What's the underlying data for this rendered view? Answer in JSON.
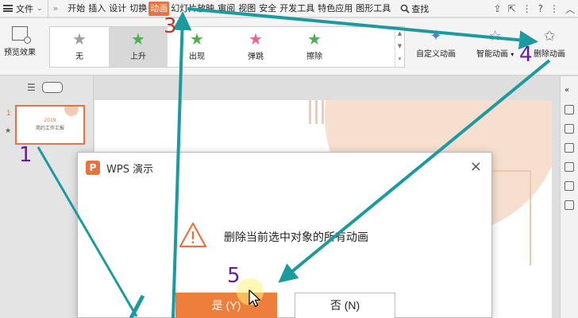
{
  "menu": {
    "file": "文件",
    "more": "»",
    "items": [
      "开始",
      "插入",
      "设计",
      "切换",
      "动画",
      "幻灯片放映",
      "审阅",
      "视图",
      "安全",
      "开发工具",
      "特色应用",
      "图形工具"
    ],
    "active_index": 4,
    "search": "查找",
    "right_icons": [
      "share-icon",
      "export-icon",
      "help-icon",
      "more-icon",
      "collapse-icon"
    ]
  },
  "ribbon": {
    "preview": "预览效果",
    "animations": [
      {
        "label": "无",
        "icon": "star-gray-icon",
        "color": "#9e9e9e"
      },
      {
        "label": "上升",
        "icon": "star-green-icon",
        "color": "#4caf50"
      },
      {
        "label": "出现",
        "icon": "star-green-icon",
        "color": "#4caf50"
      },
      {
        "label": "弹跳",
        "icon": "star-pink-icon",
        "color": "#f06292"
      },
      {
        "label": "擦除",
        "icon": "star-green-icon",
        "color": "#4caf50"
      }
    ],
    "selected_index": 1,
    "custom": "自定义动画",
    "smart": "智能动画",
    "delete": "删除动画"
  },
  "slides_panel": {
    "slide_number": "1",
    "thumb_year": "2019",
    "thumb_title": "简约工作汇报"
  },
  "dialog": {
    "logo": "P",
    "title": "WPS 演示",
    "close": "×",
    "message": "删除当前选中对象的所有动画",
    "yes": "是 (Y)",
    "no": "否 (N)"
  },
  "annotations": {
    "steps": [
      "1",
      "3",
      "4",
      "5"
    ],
    "colors": {
      "arrow": "#1b9aa0",
      "number_red": "#c0392b",
      "number_purple": "#6a1b9a"
    }
  },
  "colors": {
    "accent": "#e8733f",
    "button": "#ee7e3c"
  }
}
